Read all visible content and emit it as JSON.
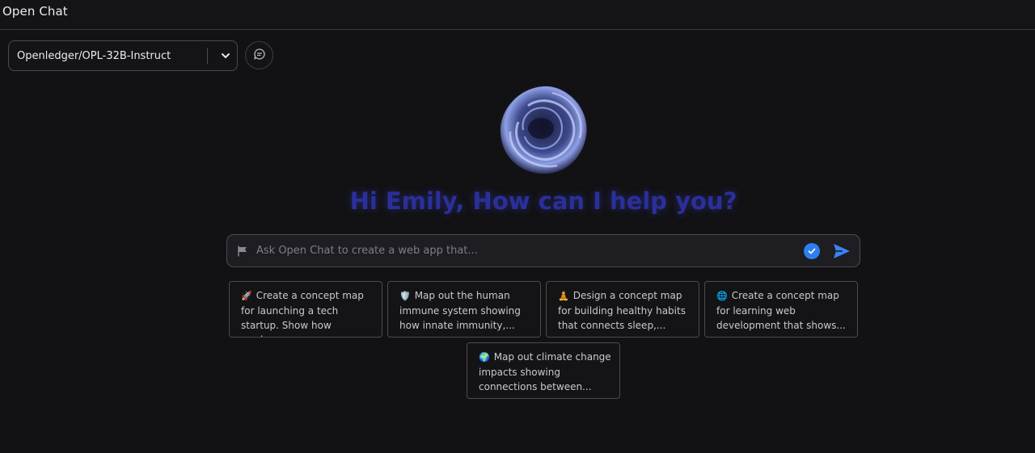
{
  "app": {
    "title": "Open Chat"
  },
  "model_selector": {
    "value": "Openledger/OPL-32B-Instruct"
  },
  "greeting": "Hi Emily, How can I help you?",
  "prompt": {
    "placeholder": "Ask Open Chat to create a web app that...",
    "value": ""
  },
  "suggestions": [
    {
      "emoji": "🚀",
      "lines": [
        "Create a concept map",
        "for launching a tech",
        "startup. Show how marke..."
      ]
    },
    {
      "emoji": "🛡️",
      "lines": [
        "Map out the human",
        "immune system showing",
        "how innate immunity,..."
      ]
    },
    {
      "emoji": "🧘",
      "lines": [
        "Design a concept map",
        "for building healthy habits",
        "that connects sleep,..."
      ]
    },
    {
      "emoji": "🌐",
      "lines": [
        "Create a concept map",
        "for learning web",
        "development that shows..."
      ]
    },
    {
      "emoji": "🌍",
      "lines": [
        "Map out climate change",
        "impacts showing",
        "connections between..."
      ]
    }
  ],
  "icons": {
    "dropdown": "chevron-down-icon",
    "new_chat": "chat-bubble-icon",
    "prompt_prefix": "flag-icon",
    "verify": "check-circle-icon",
    "send": "send-icon"
  },
  "colors": {
    "background": "#121214",
    "greeting": "#2b2f9a",
    "accent": "#2d7ff0",
    "send": "#3b82f6"
  }
}
